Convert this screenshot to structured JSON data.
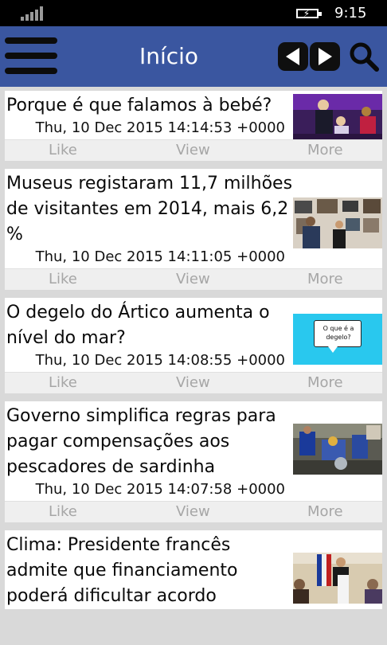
{
  "status": {
    "time": "9:15"
  },
  "header": {
    "title": "Início"
  },
  "articles": [
    {
      "title": "Porque é que falamos à bebé?",
      "date": "Thu, 10 Dec 2015 14:14:53 +0000",
      "actions": {
        "like": "Like",
        "view": "View",
        "more": "More"
      }
    },
    {
      "title": "Museus registaram 11,7 milhões de visitantes em 2014, mais 6,2 %",
      "date": "Thu, 10 Dec 2015 14:11:05 +0000",
      "actions": {
        "like": "Like",
        "view": "View",
        "more": "More"
      }
    },
    {
      "title": "O degelo do Ártico aumenta o nível do mar?",
      "date": "Thu, 10 Dec 2015 14:08:55 +0000",
      "thumb_text": "O que é a degelo?",
      "actions": {
        "like": "Like",
        "view": "View",
        "more": "More"
      }
    },
    {
      "title": "Governo simplifica regras para pagar compensações aos pescadores de sardinha",
      "date": "Thu, 10 Dec 2015 14:07:58 +0000",
      "actions": {
        "like": "Like",
        "view": "View",
        "more": "More"
      }
    },
    {
      "title": "Clima: Presidente francês admite que financiamento poderá dificultar acordo"
    }
  ],
  "colors": {
    "appbar": "#3a56a0",
    "background": "#d9d9d9",
    "statusbar": "#000000",
    "action_text": "#a6a6a6"
  }
}
